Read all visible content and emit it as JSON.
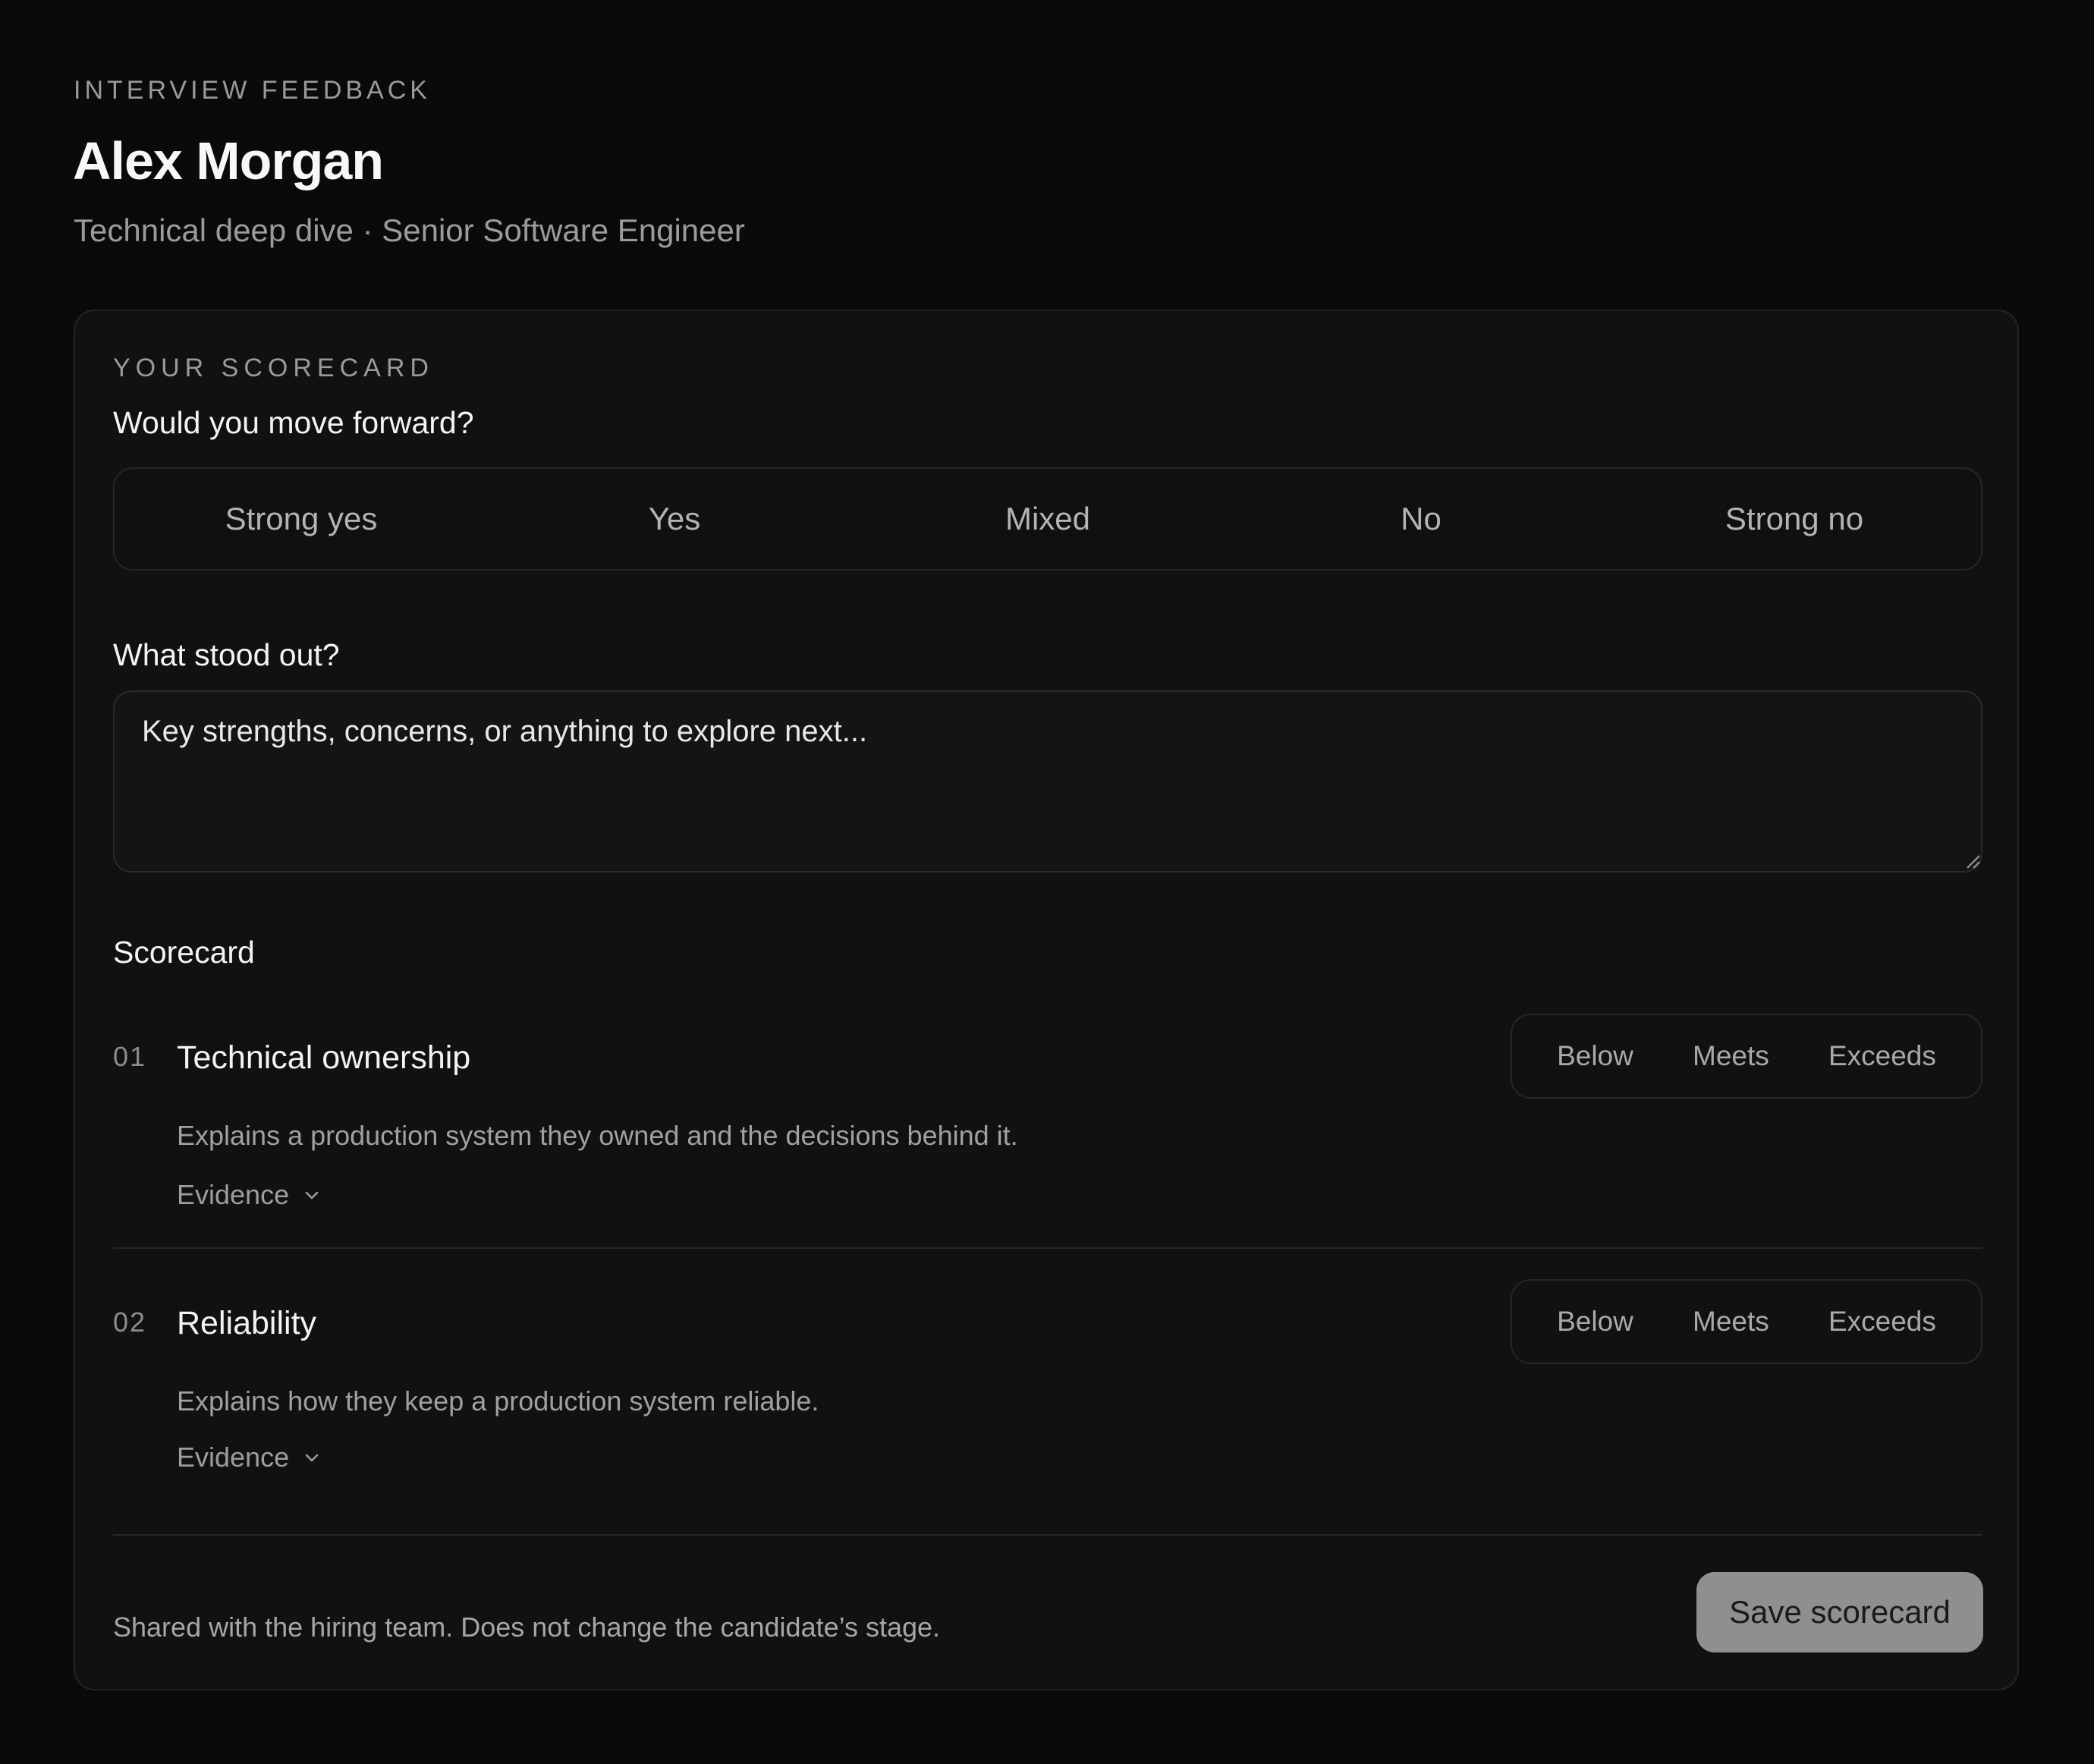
{
  "header": {
    "eyebrow": "INTERVIEW FEEDBACK",
    "candidate_name": "Alex Morgan",
    "subtitle": "Technical deep dive · Senior Software Engineer"
  },
  "scorecard": {
    "eyebrow": "YOUR SCORECARD",
    "recommendation": {
      "question": "Would you move forward?",
      "options": [
        "Strong yes",
        "Yes",
        "Mixed",
        "No",
        "Strong no"
      ],
      "selected": null
    },
    "notes": {
      "label": "What stood out?",
      "placeholder": "Key strengths, concerns, or anything to explore next...",
      "value": ""
    },
    "section_title": "Scorecard",
    "rating_options": [
      "Below",
      "Meets",
      "Exceeds"
    ],
    "criteria": [
      {
        "number": "01",
        "title": "Technical ownership",
        "description": "Explains a production system they owned and the decisions behind it.",
        "evidence_label": "Evidence"
      },
      {
        "number": "02",
        "title": "Reliability",
        "description": "Explains how they keep a production system reliable.",
        "evidence_label": "Evidence"
      }
    ],
    "footer": {
      "note": "Shared with the hiring team. Does not change the candidate’s stage.",
      "save_label": "Save scorecard"
    }
  },
  "icons": {
    "evidence_toggle": "chevron-down-icon",
    "textarea_resize": "resize-grip-icon"
  },
  "colors": {
    "background": "#0a0a0a",
    "card": "#111111",
    "border": "#262626",
    "button": "#8f8f8f"
  }
}
